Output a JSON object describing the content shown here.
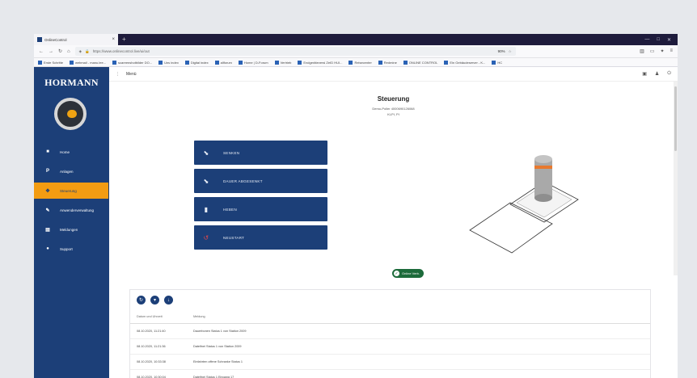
{
  "browser": {
    "tab_title": "OnlineControl",
    "url": "https://www.onlinecontrol.live/ui/out",
    "zoom": "90%",
    "bookmarks": [
      "Erste Schritte",
      "webmail - manu.lee...",
      "scareenshotbilder DO...",
      "Uns index",
      "Digital index",
      "allforum",
      "Home | D-Forum",
      "Vertrieb",
      "Endgeräteversi ZeID HUI...",
      "Reisecenter",
      "Redmine",
      "ONLINE CONTROL",
      "Ein Gebäudeserver - K...",
      "HC"
    ]
  },
  "sidebar": {
    "brand": "HORMANN",
    "items": [
      {
        "label": "Home",
        "icon": "home-icon",
        "glyph": "■"
      },
      {
        "label": "Anlagen",
        "icon": "location-pin-icon",
        "glyph": "P"
      },
      {
        "label": "Steuerung",
        "icon": "control-icon",
        "glyph": "✥"
      },
      {
        "label": "Anwenderverwaltung",
        "icon": "wrench-icon",
        "glyph": "✎"
      },
      {
        "label": "Meldungen",
        "icon": "messages-icon",
        "glyph": "▤"
      },
      {
        "label": "Support",
        "icon": "support-icon",
        "glyph": "●"
      }
    ]
  },
  "topbar": {
    "menu_label": "Menü"
  },
  "page": {
    "title": "Steuerung",
    "subtitle": "Demo-Poller 4000690126068",
    "subtitle2": "KLPI, PI"
  },
  "commands": [
    {
      "label": "SENKEN",
      "icon": "lower-icon",
      "glyph": "⬊"
    },
    {
      "label": "DAUER ABGESENKT",
      "icon": "permanent-lowered-icon",
      "glyph": "⬊"
    },
    {
      "label": "HEBEN",
      "icon": "raise-icon",
      "glyph": "▮"
    },
    {
      "label": "NEUSTART",
      "icon": "restart-icon",
      "glyph": "↺"
    }
  ],
  "status": {
    "label": "Online Verb."
  },
  "log": {
    "headers": [
      "Datum und Uhrzeit",
      "Meldung"
    ],
    "rows": [
      [
        "08.10.2020, 11:21:40",
        "Dauerbonen Status 1 von Station 2009"
      ],
      [
        "08.10.2020, 11:21:36",
        "Dateifnei Status 1 von Station 2009"
      ],
      [
        "08.10.2020, 10:33:38",
        "Einfahrten offene Schranke Status 1"
      ],
      [
        "08.10.2020, 10:30:04",
        "Dateifnei Status 1 Eingang 17"
      ]
    ]
  },
  "colors": {
    "brand_blue": "#1c3f78",
    "accent_orange": "#f39c12",
    "status_green": "#1d6b3b"
  }
}
